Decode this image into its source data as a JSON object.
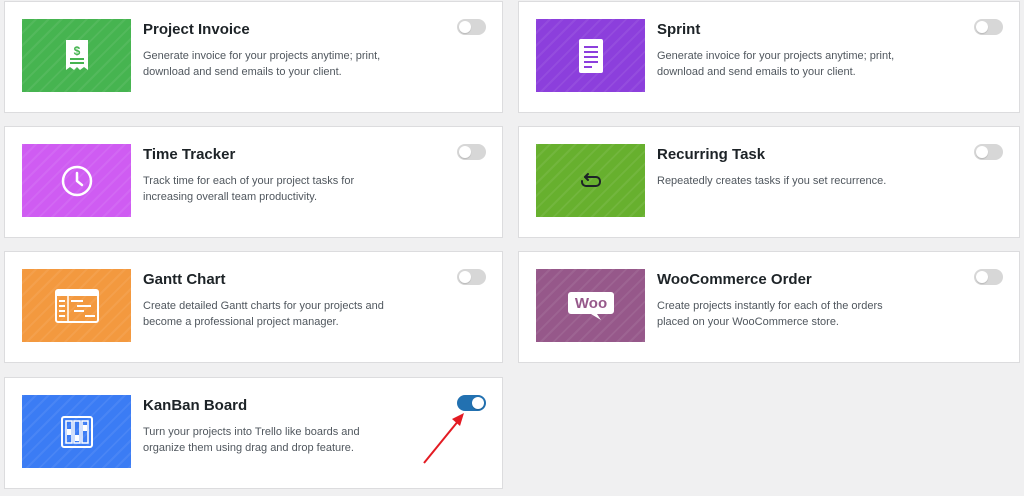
{
  "modules": [
    {
      "title": "Project Invoice",
      "description": "Generate invoice for your projects anytime; print, download and send emails to your client.",
      "color": "#46b450",
      "icon": "invoice-icon",
      "enabled": false
    },
    {
      "title": "Sprint",
      "description": "Generate invoice for your projects anytime; print, download and send emails to your client.",
      "color": "#8c3fdc",
      "icon": "document-icon",
      "enabled": false
    },
    {
      "title": "Time Tracker",
      "description": "Track time for each of your project tasks for increasing overall team productivity.",
      "color": "#cf5cf2",
      "icon": "clock-icon",
      "enabled": false
    },
    {
      "title": "Recurring Task",
      "description": "Repeatedly creates tasks if you set recurrence.",
      "color": "#67b02e",
      "icon": "recurrence-icon",
      "enabled": false
    },
    {
      "title": "Gantt Chart",
      "description": "Create detailed Gantt charts for your projects and become a professional project manager.",
      "color": "#f3993f",
      "icon": "gantt-chart-icon",
      "enabled": false
    },
    {
      "title": "WooCommerce Order",
      "description": "Create projects instantly for each of the orders placed on your WooCommerce store.",
      "color": "#96588a",
      "icon": "woo-logo-icon",
      "logo_text": "Woo",
      "enabled": false
    },
    {
      "title": "KanBan Board",
      "description": "Turn your projects into Trello like boards and organize them using drag and drop feature.",
      "color": "#3b7cf4",
      "icon": "kanban-board-icon",
      "enabled": true
    }
  ],
  "annotation": {
    "type": "red-arrow",
    "target": "kanban-board-toggle",
    "color": "#e31b23"
  }
}
